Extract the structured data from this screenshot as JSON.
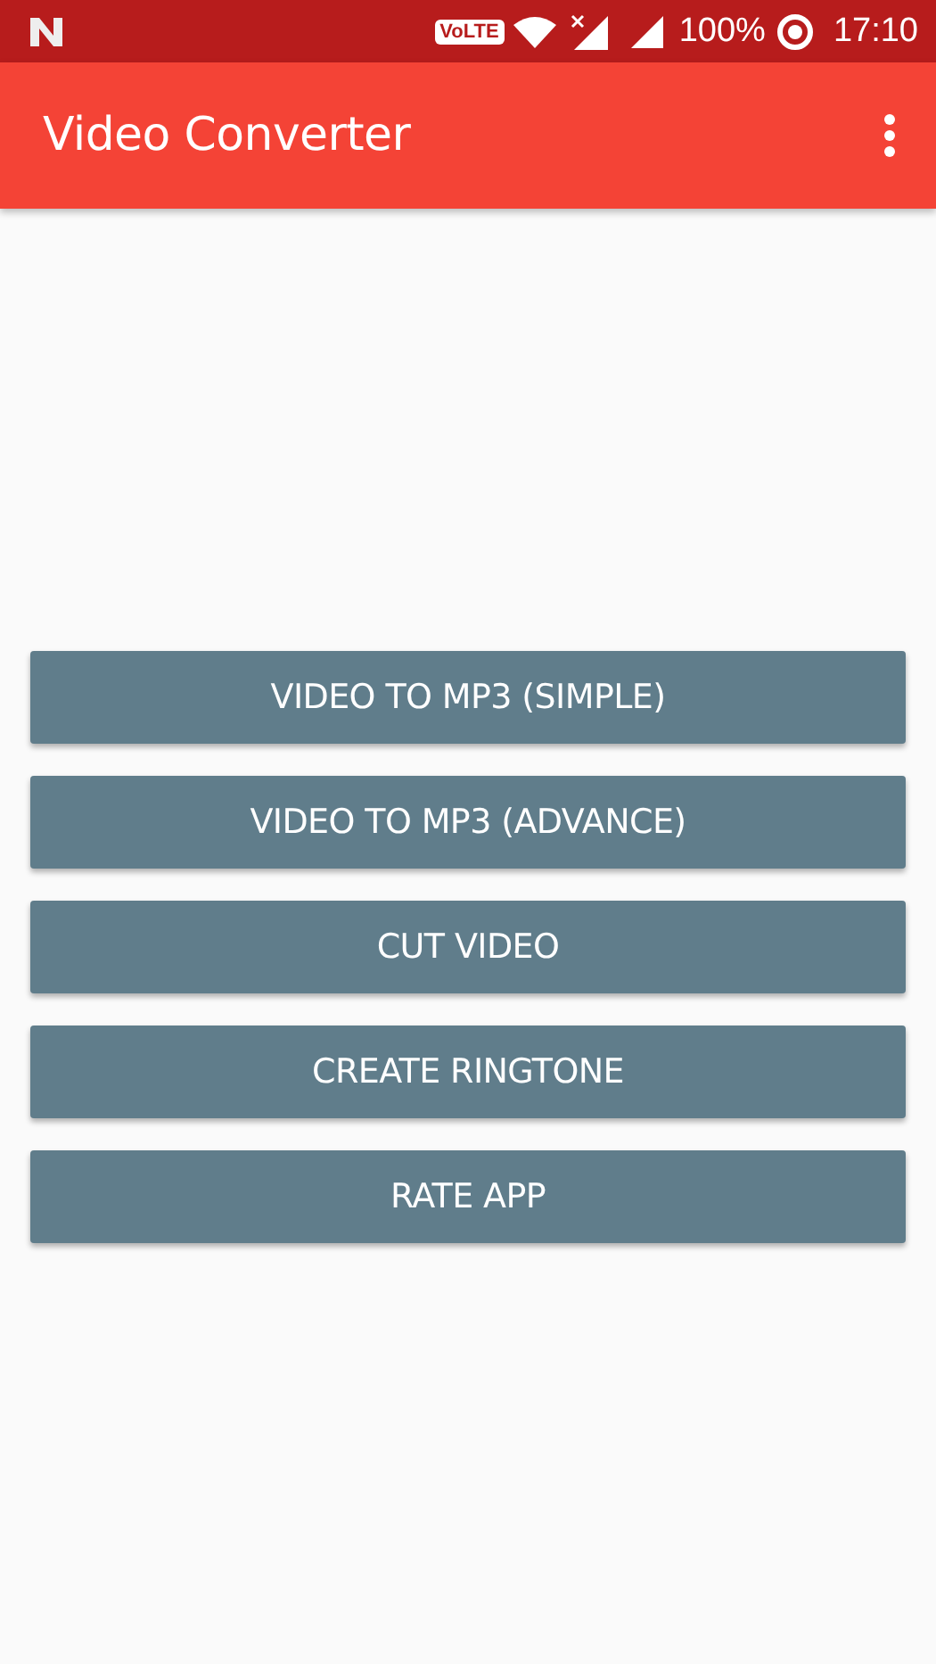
{
  "status_bar": {
    "volte": "VoLTE",
    "battery": "100%",
    "time": "17:10"
  },
  "app_bar": {
    "title": "Video Converter"
  },
  "buttons": [
    {
      "label": "VIDEO TO MP3 (SIMPLE)"
    },
    {
      "label": "VIDEO TO MP3 (ADVANCE)"
    },
    {
      "label": "CUT VIDEO"
    },
    {
      "label": "CREATE RINGTONE"
    },
    {
      "label": "RATE APP"
    }
  ]
}
